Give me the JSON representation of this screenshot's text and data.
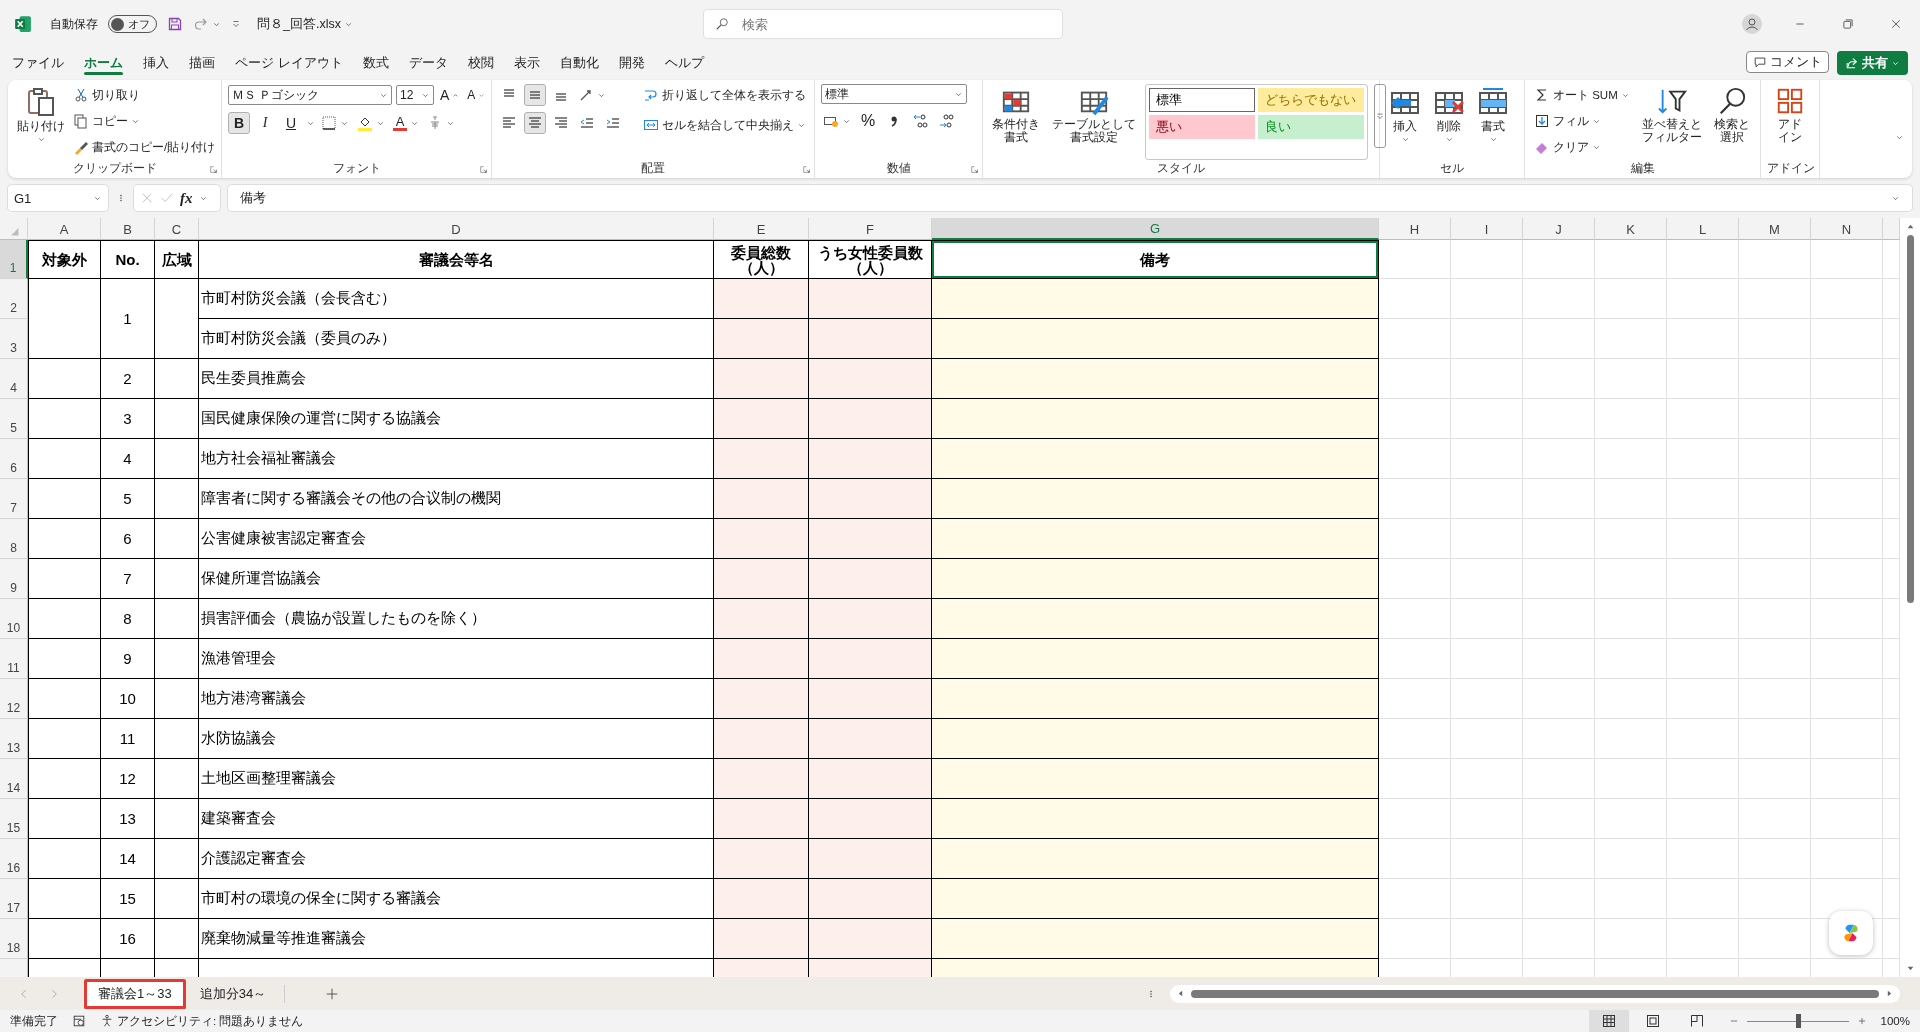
{
  "title_bar": {
    "autosave_label": "自動保存",
    "autosave": {
      "on": false,
      "label": "オフ"
    },
    "filename": "問８_回答.xlsx",
    "search": {
      "placeholder": "検索"
    }
  },
  "menu_tabs": [
    {
      "label": "ファイル",
      "selected": false
    },
    {
      "label": "ホーム",
      "selected": true
    },
    {
      "label": "挿入",
      "selected": false
    },
    {
      "label": "描画",
      "selected": false
    },
    {
      "label": "ページ レイアウト",
      "selected": false
    },
    {
      "label": "数式",
      "selected": false
    },
    {
      "label": "データ",
      "selected": false
    },
    {
      "label": "校閲",
      "selected": false
    },
    {
      "label": "表示",
      "selected": false
    },
    {
      "label": "自動化",
      "selected": false
    },
    {
      "label": "開発",
      "selected": false
    },
    {
      "label": "ヘルプ",
      "selected": false
    }
  ],
  "comment_button": "コメント",
  "share_button": "共有",
  "ribbon": {
    "clipboard": {
      "label": "クリップボード",
      "paste": "貼り付け",
      "cut": "切り取り",
      "copy": "コピー",
      "format_painter": "書式のコピー/貼り付け"
    },
    "font": {
      "label": "フォント",
      "font_name": "ＭＳ Ｐゴシック",
      "font_size": "12",
      "grow": "A",
      "shrink": "A",
      "bold": {
        "label": "B",
        "selected": true
      },
      "italic": "I",
      "underline": "U",
      "font_color": "A"
    },
    "alignment": {
      "label": "配置",
      "vertical": [
        {
          "kind": "top",
          "selected": false
        },
        {
          "kind": "middle",
          "selected": true
        },
        {
          "kind": "bottom",
          "selected": false
        }
      ],
      "horizontal": [
        {
          "kind": "left",
          "selected": false
        },
        {
          "kind": "center",
          "selected": true
        },
        {
          "kind": "right",
          "selected": false
        }
      ],
      "wrap_text": "折り返して全体を表示する",
      "merge_center": "セルを結合して中央揃え"
    },
    "number": {
      "label": "数値",
      "format": "標準",
      "percent": "%"
    },
    "styles": {
      "label": "スタイル",
      "conditional": [
        "条件付き",
        "書式"
      ],
      "format_as_table": [
        "テーブルとして",
        "書式設定"
      ],
      "cell_styles": [
        {
          "label": "標準",
          "color": "#ffffff",
          "selected": true
        },
        {
          "label": "どちらでもない",
          "color": "#ffeb9c",
          "selected": false
        },
        {
          "label": "悪い",
          "color": "#ffc7ce",
          "selected": false
        },
        {
          "label": "良い",
          "color": "#c6efce",
          "selected": false
        }
      ]
    },
    "cells": {
      "label": "セル",
      "buttons": [
        {
          "kind": "insert",
          "label": "挿入"
        },
        {
          "kind": "delete",
          "label": "削除"
        },
        {
          "kind": "format",
          "label": "書式"
        }
      ]
    },
    "editing": {
      "label": "編集",
      "autosum": "オート SUM",
      "fill": "フィル",
      "clear": "クリア",
      "sort_filter": [
        "並べ替えと",
        "フィルター"
      ],
      "find_select": [
        "検索と",
        "選択"
      ]
    },
    "addins": {
      "label": "アドイン",
      "button": [
        "アド",
        "イン"
      ]
    }
  },
  "formula_bar": {
    "name_box": "G1",
    "fx": "fx",
    "content": "備考"
  },
  "sheet": {
    "columns": [
      {
        "label": "A",
        "selected": false
      },
      {
        "label": "B",
        "selected": false
      },
      {
        "label": "C",
        "selected": false
      },
      {
        "label": "D",
        "selected": false
      },
      {
        "label": "E",
        "selected": false
      },
      {
        "label": "F",
        "selected": false
      },
      {
        "label": "G",
        "selected": true
      },
      {
        "label": "H",
        "selected": false
      },
      {
        "label": "I",
        "selected": false
      },
      {
        "label": "J",
        "selected": false
      },
      {
        "label": "K",
        "selected": false
      },
      {
        "label": "L",
        "selected": false
      },
      {
        "label": "M",
        "selected": false
      },
      {
        "label": "N",
        "selected": false
      }
    ],
    "row_numbers": [
      {
        "label": "1",
        "selected": true
      },
      {
        "label": "2",
        "selected": false
      },
      {
        "label": "3",
        "selected": false
      },
      {
        "label": "4",
        "selected": false
      },
      {
        "label": "5",
        "selected": false
      },
      {
        "label": "6",
        "selected": false
      },
      {
        "label": "7",
        "selected": false
      },
      {
        "label": "8",
        "selected": false
      },
      {
        "label": "9",
        "selected": false
      },
      {
        "label": "10",
        "selected": false
      },
      {
        "label": "11",
        "selected": false
      },
      {
        "label": "12",
        "selected": false
      },
      {
        "label": "13",
        "selected": false
      },
      {
        "label": "14",
        "selected": false
      },
      {
        "label": "15",
        "selected": false
      },
      {
        "label": "16",
        "selected": false
      },
      {
        "label": "17",
        "selected": false
      },
      {
        "label": "18",
        "selected": false
      }
    ],
    "header_cells": [
      {
        "text": "対象外",
        "selected": false
      },
      {
        "text": "No.",
        "selected": false
      },
      {
        "text": "広域",
        "selected": false
      },
      {
        "text": "審議会等名",
        "selected": false
      },
      {
        "text": "委員総数（人）",
        "selected": false
      },
      {
        "text": "うち女性委員数（人）",
        "selected": false
      },
      {
        "text": "備考",
        "selected": true
      }
    ],
    "groups": [
      {
        "no": "1",
        "names": [
          "市町村防災会議（会長含む）",
          "市町村防災会議（委員のみ）"
        ]
      },
      {
        "no": "2",
        "names": [
          "民生委員推薦会"
        ]
      },
      {
        "no": "3",
        "names": [
          "国民健康保険の運営に関する協議会"
        ]
      },
      {
        "no": "4",
        "names": [
          "地方社会福祉審議会"
        ]
      },
      {
        "no": "5",
        "names": [
          "障害者に関する審議会その他の合议制の機関"
        ]
      },
      {
        "no": "6",
        "names": [
          "公害健康被害認定審査会"
        ]
      },
      {
        "no": "7",
        "names": [
          "保健所運営協議会"
        ]
      },
      {
        "no": "8",
        "names": [
          "損害評価会（農協が設置したものを除く）"
        ]
      },
      {
        "no": "9",
        "names": [
          "漁港管理会"
        ]
      },
      {
        "no": "10",
        "names": [
          "地方港湾審議会"
        ]
      },
      {
        "no": "11",
        "names": [
          "水防協議会"
        ]
      },
      {
        "no": "12",
        "names": [
          "土地区画整理審議会"
        ]
      },
      {
        "no": "13",
        "names": [
          "建築審査会"
        ]
      },
      {
        "no": "14",
        "names": [
          "介護認定審査会"
        ]
      },
      {
        "no": "15",
        "names": [
          "市町村の環境の保全に関する審議会"
        ]
      },
      {
        "no": "16",
        "names": [
          "廃棄物減量等推進審議会"
        ]
      }
    ]
  },
  "sheet_tabs": [
    {
      "label": "審議会1～33",
      "selected": true
    },
    {
      "label": "追加分34～",
      "selected": false
    }
  ],
  "status_bar": {
    "ready": "準備完了",
    "accessibility": "アクセシビリティ: 問題ありません",
    "views": [
      {
        "kind": "normal",
        "selected": true
      },
      {
        "kind": "page_layout",
        "selected": false
      },
      {
        "kind": "page_break",
        "selected": false
      }
    ],
    "zoom_slider": {
      "level": 0.5
    },
    "zoom": "100%"
  }
}
